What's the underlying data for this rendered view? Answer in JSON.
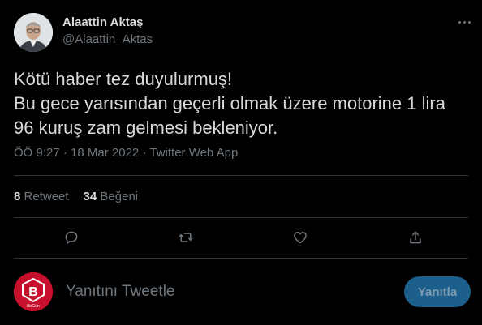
{
  "author": {
    "display_name": "Alaattin Aktaş",
    "handle": "@Alaattin_Aktas"
  },
  "tweet": {
    "lines": [
      "Kötü haber tez duyulurmuş!",
      "Bu gece yarısından geçerli olmak üzere motorine 1 lira",
      "96 kuruş zam gelmesi bekleniyor."
    ],
    "time": "ÖÖ 9:27",
    "date": "18 Mar 2022",
    "source": "Twitter Web App"
  },
  "stats": {
    "retweets_count": "8",
    "retweets_label": "Retweet",
    "likes_count": "34",
    "likes_label": "Beğeni"
  },
  "actions": {
    "reply_icon": "comment-icon",
    "retweet_icon": "retweet-icon",
    "like_icon": "heart-icon",
    "share_icon": "share-icon"
  },
  "reply": {
    "placeholder": "Yanıtını Tweetle",
    "button_label": "Yanıtla",
    "avatar_letter": "B",
    "avatar_caption": "BirGün"
  },
  "colors": {
    "background": "#000000",
    "text": "#d9d9d9",
    "secondary": "#6e767d",
    "divider": "#2f3336",
    "reply_button": "#1d5f8c",
    "reply_avatar": "#c8102e"
  }
}
